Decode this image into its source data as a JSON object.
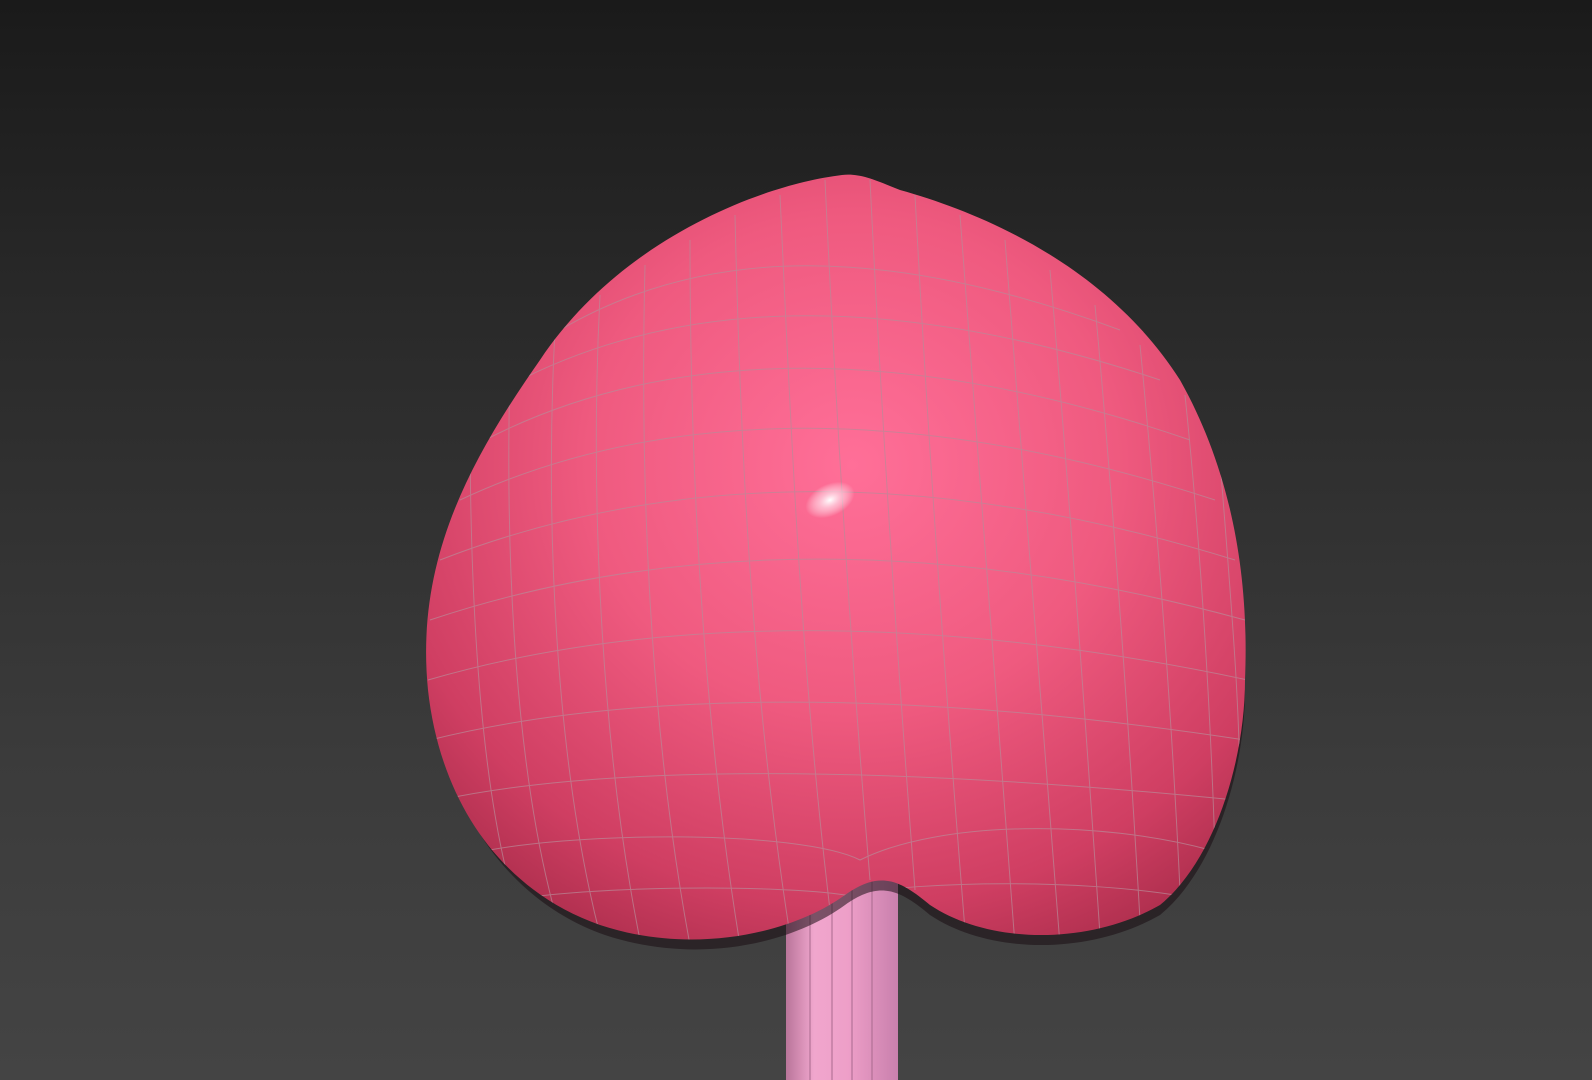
{
  "viewport": {
    "background_top": "#1a1a1a",
    "background_bottom": "#444444"
  },
  "model": {
    "heart_color": "#f25a80",
    "heart_shadow_color": "#c63a5b",
    "wire_color": "#8a8a8a",
    "stick_color": "#eea0c8",
    "stick_shadow_color": "#c77aa6",
    "highlight_color": "#ffffff"
  }
}
